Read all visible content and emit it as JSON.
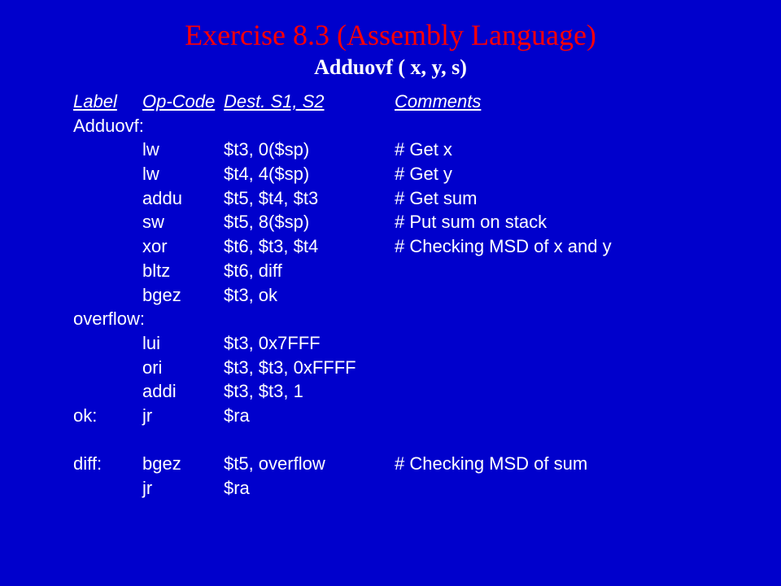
{
  "title": "Exercise 8.3 (Assembly Language)",
  "subtitle": "Adduovf ( x, y, s)",
  "headers": {
    "label": "Label",
    "opcode": "Op-Code",
    "args": "Dest. S1, S2",
    "comments": "Comments"
  },
  "lines": [
    {
      "type": "label",
      "label": "Adduovf:"
    },
    {
      "type": "instr",
      "label": "",
      "op": "lw",
      "args": "$t3,  0($sp)",
      "cmt": "# Get x"
    },
    {
      "type": "instr",
      "label": "",
      "op": "lw",
      "args": "$t4,  4($sp)",
      "cmt": "# Get y"
    },
    {
      "type": "instr",
      "label": "",
      "op": "addu",
      "args": "$t5, $t4, $t3",
      "cmt": "# Get sum"
    },
    {
      "type": "instr",
      "label": "",
      "op": "sw",
      "args": "$t5, 8($sp)",
      "cmt": "# Put sum on stack"
    },
    {
      "type": "instr",
      "label": "",
      "op": "xor",
      "args": "$t6, $t3, $t4",
      "cmt": "# Checking MSD of x and y"
    },
    {
      "type": "instr",
      "label": "",
      "op": "bltz",
      "args": "$t6, diff",
      "cmt": ""
    },
    {
      "type": "instr",
      "label": "",
      "op": "bgez",
      "args": "$t3, ok",
      "cmt": ""
    },
    {
      "type": "label",
      "label": "overflow:"
    },
    {
      "type": "instr",
      "label": "",
      "op": "lui",
      "args": "$t3, 0x7FFF",
      "cmt": ""
    },
    {
      "type": "instr",
      "label": "",
      "op": "ori",
      "args": "$t3, $t3, 0xFFFF",
      "cmt": ""
    },
    {
      "type": "instr",
      "label": "",
      "op": "addi",
      "args": "$t3, $t3, 1",
      "cmt": ""
    },
    {
      "type": "instr",
      "label": "ok:",
      "op": "jr",
      "args": "$ra",
      "cmt": ""
    },
    {
      "type": "blank"
    },
    {
      "type": "instr",
      "label": "diff:",
      "op": "bgez",
      "args": "$t5, overflow",
      "cmt": "# Checking MSD of sum"
    },
    {
      "type": "instr",
      "label": "",
      "op": "jr",
      "args": "$ra",
      "cmt": ""
    }
  ]
}
